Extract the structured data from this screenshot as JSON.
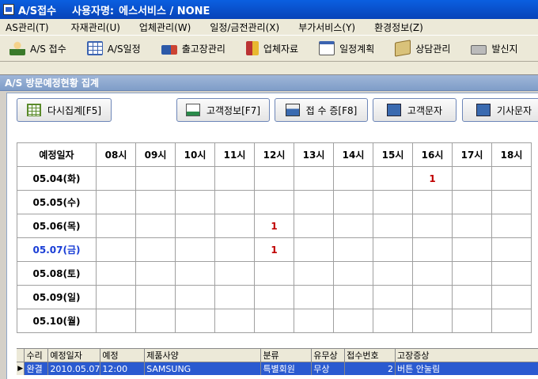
{
  "window": {
    "title": "A/S접수",
    "user_label": "사용자명:",
    "user": "에스서비스 / NONE"
  },
  "menu": [
    "AS관리(T)",
    "자재관리(U)",
    "업체관리(W)",
    "일정/금전관리(X)",
    "부가서비스(Y)",
    "환경정보(Z)"
  ],
  "toolbar": [
    {
      "label": "A/S 접수",
      "icon": "person-icon"
    },
    {
      "label": "A/S일정",
      "icon": "table-icon"
    },
    {
      "label": "출고장관리",
      "icon": "truck-icon"
    },
    {
      "label": "업체자료",
      "icon": "book-icon"
    },
    {
      "label": "일정계획",
      "icon": "calendar-icon"
    },
    {
      "label": "상담관리",
      "icon": "tag-icon"
    },
    {
      "label": "발신지",
      "icon": "phone-icon"
    }
  ],
  "panel": {
    "title": "A/S 방문예정현황 집계"
  },
  "buttons": {
    "refresh": "다시집계[F5]",
    "customer_info": "고객정보[F7]",
    "receipt": "접 수 증[F8]",
    "customer_sms": "고객문자",
    "tech_sms": "기사문자"
  },
  "grid": {
    "header_date": "예정일자",
    "hours": [
      "08시",
      "09시",
      "10시",
      "11시",
      "12시",
      "13시",
      "14시",
      "15시",
      "16시",
      "17시",
      "18시"
    ],
    "rows": [
      {
        "date": "05.04(화)",
        "cells": [
          "",
          "",
          "",
          "",
          "",
          "",
          "",
          "",
          "1",
          "",
          ""
        ]
      },
      {
        "date": "05.05(수)",
        "cells": [
          "",
          "",
          "",
          "",
          "",
          "",
          "",
          "",
          "",
          "",
          ""
        ]
      },
      {
        "date": "05.06(목)",
        "cells": [
          "",
          "",
          "",
          "",
          "1",
          "",
          "",
          "",
          "",
          "",
          ""
        ]
      },
      {
        "date": "05.07(금)",
        "cells": [
          "",
          "",
          "",
          "",
          "1",
          "",
          "",
          "",
          "",
          "",
          ""
        ],
        "highlight": true
      },
      {
        "date": "05.08(토)",
        "cells": [
          "",
          "",
          "",
          "",
          "",
          "",
          "",
          "",
          "",
          "",
          ""
        ]
      },
      {
        "date": "05.09(일)",
        "cells": [
          "",
          "",
          "",
          "",
          "",
          "",
          "",
          "",
          "",
          "",
          ""
        ]
      },
      {
        "date": "05.10(월)",
        "cells": [
          "",
          "",
          "",
          "",
          "",
          "",
          "",
          "",
          "",
          "",
          ""
        ]
      }
    ]
  },
  "list": {
    "columns": [
      "수리",
      "예정일자",
      "예정",
      "제품사양",
      "분류",
      "유무상",
      "접수번호",
      "고장증상"
    ],
    "rows": [
      {
        "values": [
          "완결",
          "2010.05.07",
          "12:00",
          "SAMSUNG",
          "특별회원",
          "무상",
          "2",
          "버튼 안눌림"
        ]
      }
    ]
  },
  "colors": {
    "title_bar": "#0a5fe0",
    "selected_row": "#2a5ad0",
    "count": "#c00000",
    "highlight_date": "#1a3ed6"
  }
}
